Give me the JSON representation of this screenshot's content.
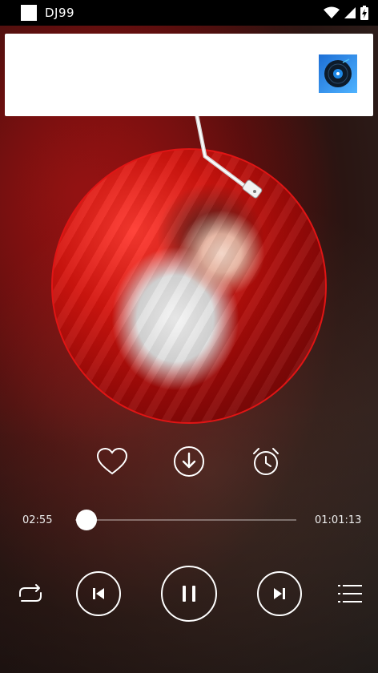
{
  "status_bar": {
    "title": "DJ99"
  },
  "ad": {
    "logo_icon": "dj-disc-logo-icon"
  },
  "player": {
    "elapsed": "02:55",
    "duration": "01:01:13",
    "progress_fraction": 0.05,
    "state": "playing"
  },
  "actions": [
    {
      "icon": "heart-icon"
    },
    {
      "icon": "download-icon"
    },
    {
      "icon": "alarm-clock-icon"
    }
  ],
  "controls": [
    {
      "icon": "repeat-icon"
    },
    {
      "icon": "previous-icon"
    },
    {
      "icon": "pause-icon"
    },
    {
      "icon": "next-icon"
    },
    {
      "icon": "playlist-icon"
    }
  ],
  "colors": {
    "disc_border": "#e01515",
    "accent": "#ffffff"
  }
}
